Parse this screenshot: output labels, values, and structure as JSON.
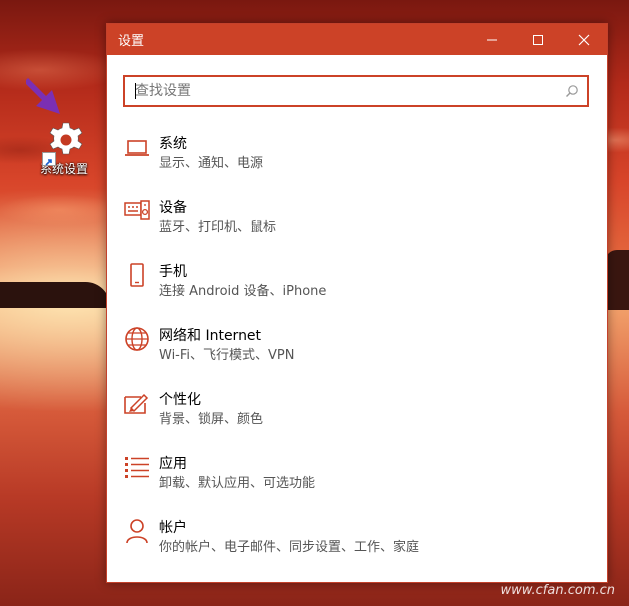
{
  "desktop": {
    "icon_label": "系统设置",
    "watermark": "www.cfan.com.cn"
  },
  "window": {
    "title": "设置",
    "search_placeholder": "查找设置",
    "items": [
      {
        "name": "系统",
        "desc": "显示、通知、电源",
        "icon": "laptop-icon"
      },
      {
        "name": "设备",
        "desc": "蓝牙、打印机、鼠标",
        "icon": "devices-icon"
      },
      {
        "name": "手机",
        "desc": "连接 Android 设备、iPhone",
        "icon": "phone-icon"
      },
      {
        "name": "网络和 Internet",
        "desc": "Wi-Fi、飞行模式、VPN",
        "icon": "globe-icon"
      },
      {
        "name": "个性化",
        "desc": "背景、锁屏、颜色",
        "icon": "paint-icon"
      },
      {
        "name": "应用",
        "desc": "卸载、默认应用、可选功能",
        "icon": "apps-list-icon"
      },
      {
        "name": "帐户",
        "desc": "你的帐户、电子邮件、同步设置、工作、家庭",
        "icon": "person-icon"
      }
    ]
  },
  "colors": {
    "accent": "#cc4227",
    "arrow": "#7b2fb3"
  }
}
